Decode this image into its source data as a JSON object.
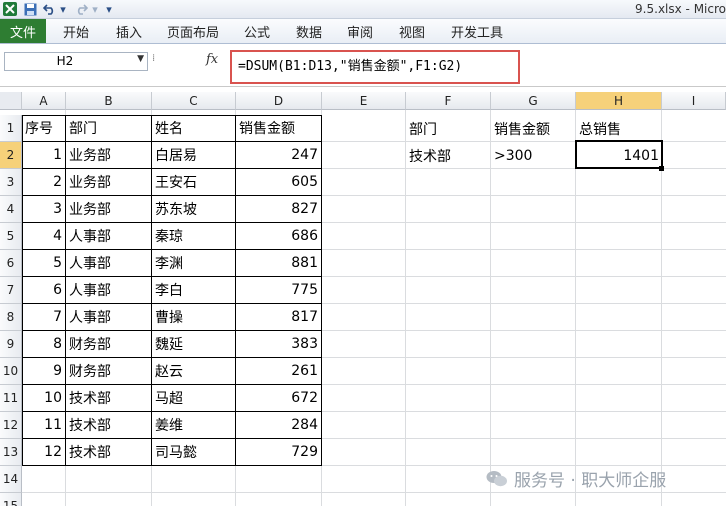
{
  "window": {
    "title": "9.5.xlsx - Micro"
  },
  "ribbon": {
    "file_tab": "文件",
    "tabs": [
      "开始",
      "插入",
      "页面布局",
      "公式",
      "数据",
      "审阅",
      "视图",
      "开发工具"
    ]
  },
  "formula_bar": {
    "name_box": "H2",
    "fx_label": "fx",
    "formula": "=DSUM(B1:D13,\"销售金额\",F1:G2)"
  },
  "columns": [
    "A",
    "B",
    "C",
    "D",
    "E",
    "F",
    "G",
    "H",
    "I"
  ],
  "rows": [
    "1",
    "2",
    "3",
    "4",
    "5",
    "6",
    "7",
    "8",
    "9",
    "10",
    "11",
    "12",
    "13",
    "14",
    "15"
  ],
  "table": {
    "headers": [
      "序号",
      "部门",
      "姓名",
      "销售金额"
    ],
    "rows": [
      [
        "1",
        "业务部",
        "白居易",
        "247"
      ],
      [
        "2",
        "业务部",
        "王安石",
        "605"
      ],
      [
        "3",
        "业务部",
        "苏东坡",
        "827"
      ],
      [
        "4",
        "人事部",
        "秦琼",
        "686"
      ],
      [
        "5",
        "人事部",
        "李渊",
        "881"
      ],
      [
        "6",
        "人事部",
        "李白",
        "775"
      ],
      [
        "7",
        "人事部",
        "曹操",
        "817"
      ],
      [
        "8",
        "财务部",
        "魏延",
        "383"
      ],
      [
        "9",
        "财务部",
        "赵云",
        "261"
      ],
      [
        "10",
        "技术部",
        "马超",
        "672"
      ],
      [
        "11",
        "技术部",
        "姜维",
        "284"
      ],
      [
        "12",
        "技术部",
        "司马懿",
        "729"
      ]
    ]
  },
  "criteria": {
    "header_f": "部门",
    "header_g": "销售金额",
    "header_h": "总销售",
    "value_f": "技术部",
    "value_g": ">300",
    "value_h": "1401"
  },
  "watermark": {
    "text": "服务号 · 职大师企服"
  },
  "colors": {
    "file_tab": "#2e7d32",
    "selected_header": "#f6d17a",
    "highlight_box": "#d9534f"
  }
}
